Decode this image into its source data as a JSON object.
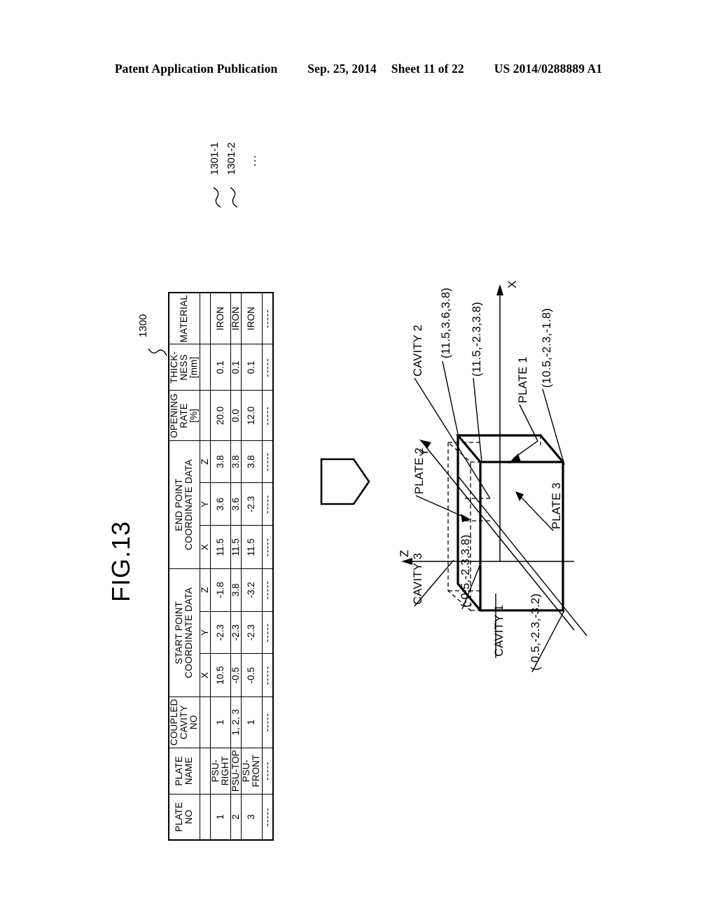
{
  "header": {
    "publication": "Patent Application Publication",
    "date": "Sep. 25, 2014",
    "sheet": "Sheet 11 of 22",
    "patent_number": "US 2014/0288889 A1"
  },
  "figure": {
    "label": "FIG.13"
  },
  "refs": {
    "table_ref": "1300",
    "row_ref_1": "1301-1",
    "row_ref_2": "1301-2",
    "row_ref_more": "..."
  },
  "table": {
    "dots": "-----",
    "columns": [
      {
        "key": "plate_no",
        "header": "PLATE NO"
      },
      {
        "key": "plate_name",
        "header": "PLATE\nNAME"
      },
      {
        "key": "coupled_cavity",
        "header": "COUPLED\nCAVITY NO"
      },
      {
        "key": "start_point",
        "header": "START POINT\nCOORDINATE DATA",
        "sub": [
          "X",
          "Y",
          "Z"
        ]
      },
      {
        "key": "end_point",
        "header": "END POINT\nCOORDINATE DATA",
        "sub": [
          "X",
          "Y",
          "Z"
        ]
      },
      {
        "key": "opening_rate",
        "header": "OPENING\nRATE\n[%]"
      },
      {
        "key": "thickness",
        "header": "THICK-\nNESS\n[mm]"
      },
      {
        "key": "material",
        "header": "MATERIAL"
      }
    ],
    "headers": {
      "plate_no": "PLATE NO",
      "plate_name_l1": "PLATE",
      "plate_name_l2": "NAME",
      "coupled_l1": "COUPLED",
      "coupled_l2": "CAVITY NO",
      "start_l1": "START POINT",
      "start_l2": "COORDINATE DATA",
      "end_l1": "END POINT",
      "end_l2": "COORDINATE DATA",
      "opening_l1": "OPENING",
      "opening_l2": "RATE",
      "opening_l3": "[%]",
      "thickness_l1": "THICK-",
      "thickness_l2": "NESS",
      "thickness_l3": "[mm]",
      "material": "MATERIAL",
      "sub_x": "X",
      "sub_y": "Y",
      "sub_z": "Z"
    },
    "rows": [
      {
        "plate_no": "1",
        "plate_name": "PSU-RIGHT",
        "coupled_cavity": "1",
        "start_x": "10.5",
        "start_y": "-2.3",
        "start_z": "-1.8",
        "end_x": "11.5",
        "end_y": "3.6",
        "end_z": "3.8",
        "opening_rate": "20.0",
        "thickness": "0.1",
        "material": "IRON"
      },
      {
        "plate_no": "2",
        "plate_name": "PSU-TOP",
        "coupled_cavity": "1, 2, 3",
        "start_x": "-0.5",
        "start_y": "-2.3",
        "start_z": "3.8",
        "end_x": "11.5",
        "end_y": "3.6",
        "end_z": "3.8",
        "opening_rate": "0.0",
        "thickness": "0.1",
        "material": "IRON"
      },
      {
        "plate_no": "3",
        "plate_name": "PSU-FRONT",
        "coupled_cavity": "1",
        "start_x": "-0.5",
        "start_y": "-2.3",
        "start_z": "-3.2",
        "end_x": "11.5",
        "end_y": "-2.3",
        "end_z": "3.8",
        "opening_rate": "12.0",
        "thickness": "0.1",
        "material": "IRON"
      },
      {
        "plate_no": "-----",
        "plate_name": "-----",
        "coupled_cavity": "-----",
        "start_x": "-----",
        "start_y": "-----",
        "start_z": "-----",
        "end_x": "-----",
        "end_y": "-----",
        "end_z": "-----",
        "opening_rate": "-----",
        "thickness": "-----",
        "material": "-----"
      }
    ]
  },
  "diagram": {
    "axes": {
      "x": "X",
      "y": "Y",
      "z": "Z"
    },
    "plates": [
      {
        "name": "PLATE 1"
      },
      {
        "name": "PLATE 2"
      },
      {
        "name": "PLATE 3"
      }
    ],
    "cavities": [
      {
        "name": "CAVITY 1"
      },
      {
        "name": "CAVITY 2"
      },
      {
        "name": "CAVITY 3"
      }
    ],
    "coordinates": [
      "(11.5,3.6,3.8)",
      "(11.5,-2.3,3.8)",
      "(10.5,-2.3,-1.8)",
      "(-0.5,-2.3,3.8)",
      "(-0.5,-2.3,-3.2)"
    ],
    "coord_top_right": "(11.5,3.6,3.8)",
    "coord_mid_right": "(11.5,-2.3,3.8)",
    "coord_plate1": "(10.5,-2.3,-1.8)",
    "coord_left_top": "(-0.5,-2.3,3.8)",
    "coord_left_bottom": "(-0.5,-2.3,-3.2)"
  },
  "colors": {
    "ink": "#000000",
    "paper": "#ffffff"
  }
}
